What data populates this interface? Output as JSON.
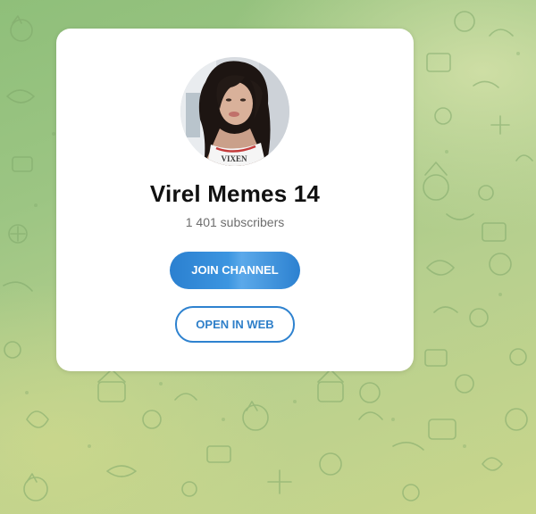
{
  "channel": {
    "title": "Virel Memes 14",
    "subscribers": "1 401 subscribers",
    "avatar_shirt_text": "VIXEN"
  },
  "actions": {
    "join_label": "JOIN CHANNEL",
    "web_label": "OPEN IN WEB"
  },
  "colors": {
    "accent": "#2e82cf",
    "background": "#a8ca86",
    "card": "#ffffff"
  },
  "background_pattern": "doodle-pattern"
}
